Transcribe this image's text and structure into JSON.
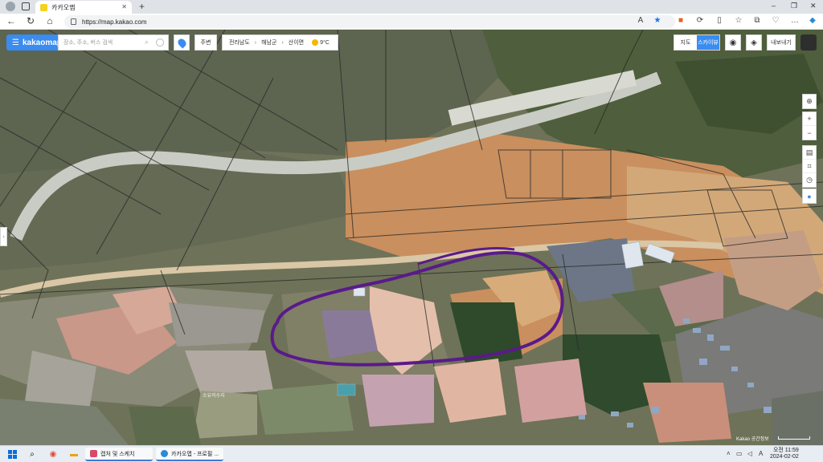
{
  "browser": {
    "tab_title": "카카오맵",
    "tab_close": "✕",
    "new_tab": "+",
    "url": "https://map.kakao.com",
    "window_controls": [
      "–",
      "❐",
      "✕"
    ],
    "toolbar_icons": [
      "read-aloud-icon",
      "favorite-star-icon",
      "extension-icon",
      "refresh-sync-icon",
      "split-screen-icon",
      "favorites-icon",
      "collections-icon",
      "browser-essentials-icon",
      "more-icon",
      "copilot-icon"
    ]
  },
  "map": {
    "logo": "kakaomap",
    "menu_icon": "☰",
    "search_placeholder": "장소, 주소, 버스 검색",
    "nearby_label": "주변",
    "breadcrumb": [
      "전라남도",
      "해남군",
      "산이면"
    ],
    "weather": "9°C",
    "mode_map": "지도",
    "mode_skyview": "스카이뷰",
    "export_label": "내보내기",
    "side_toggle": "›",
    "place_label": "소유저수지",
    "copyright": "Kakao 공간정보",
    "right_tools": [
      "locate-icon",
      "zoom-in-icon",
      "zoom-out-icon",
      "roadview-icon",
      "distance-icon",
      "radius-icon",
      "pin-icon"
    ],
    "annotation_color": "#5a1a8a",
    "accent_color": "#3a8cf0"
  },
  "taskbar": {
    "apps": [
      {
        "label": "캡처 및 스케치",
        "icon": "snipping-tool-icon"
      },
      {
        "label": "카카오맵 - 프로필 ...",
        "icon": "edge-browser-icon"
      }
    ],
    "tray_lang": "A",
    "time": "오전 11:59",
    "date": "2024-02-02"
  }
}
